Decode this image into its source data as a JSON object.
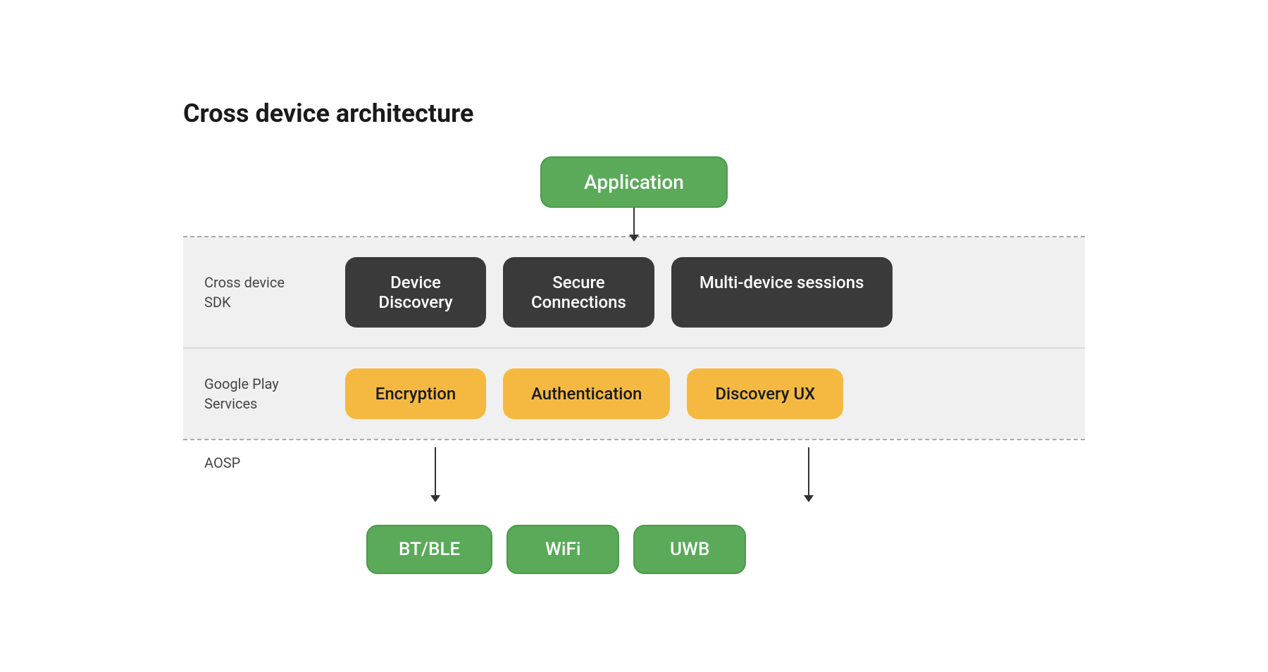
{
  "title": "Cross device architecture",
  "application_box": "Application",
  "sdk_label": "Cross device\nSDK",
  "sdk_boxes": [
    {
      "id": "device-discovery",
      "label": "Device\nDiscovery"
    },
    {
      "id": "secure-connections",
      "label": "Secure\nConnections"
    },
    {
      "id": "multi-device-sessions",
      "label": "Multi-device sessions"
    }
  ],
  "play_label": "Google Play\nServices",
  "play_boxes": [
    {
      "id": "encryption",
      "label": "Encryption"
    },
    {
      "id": "authentication",
      "label": "Authentication"
    },
    {
      "id": "discovery-ux",
      "label": "Discovery UX"
    }
  ],
  "aosp_label": "AOSP",
  "bottom_boxes": [
    {
      "id": "bt-ble",
      "label": "BT/BLE"
    },
    {
      "id": "wifi",
      "label": "WiFi"
    },
    {
      "id": "uwb",
      "label": "UWB"
    }
  ]
}
